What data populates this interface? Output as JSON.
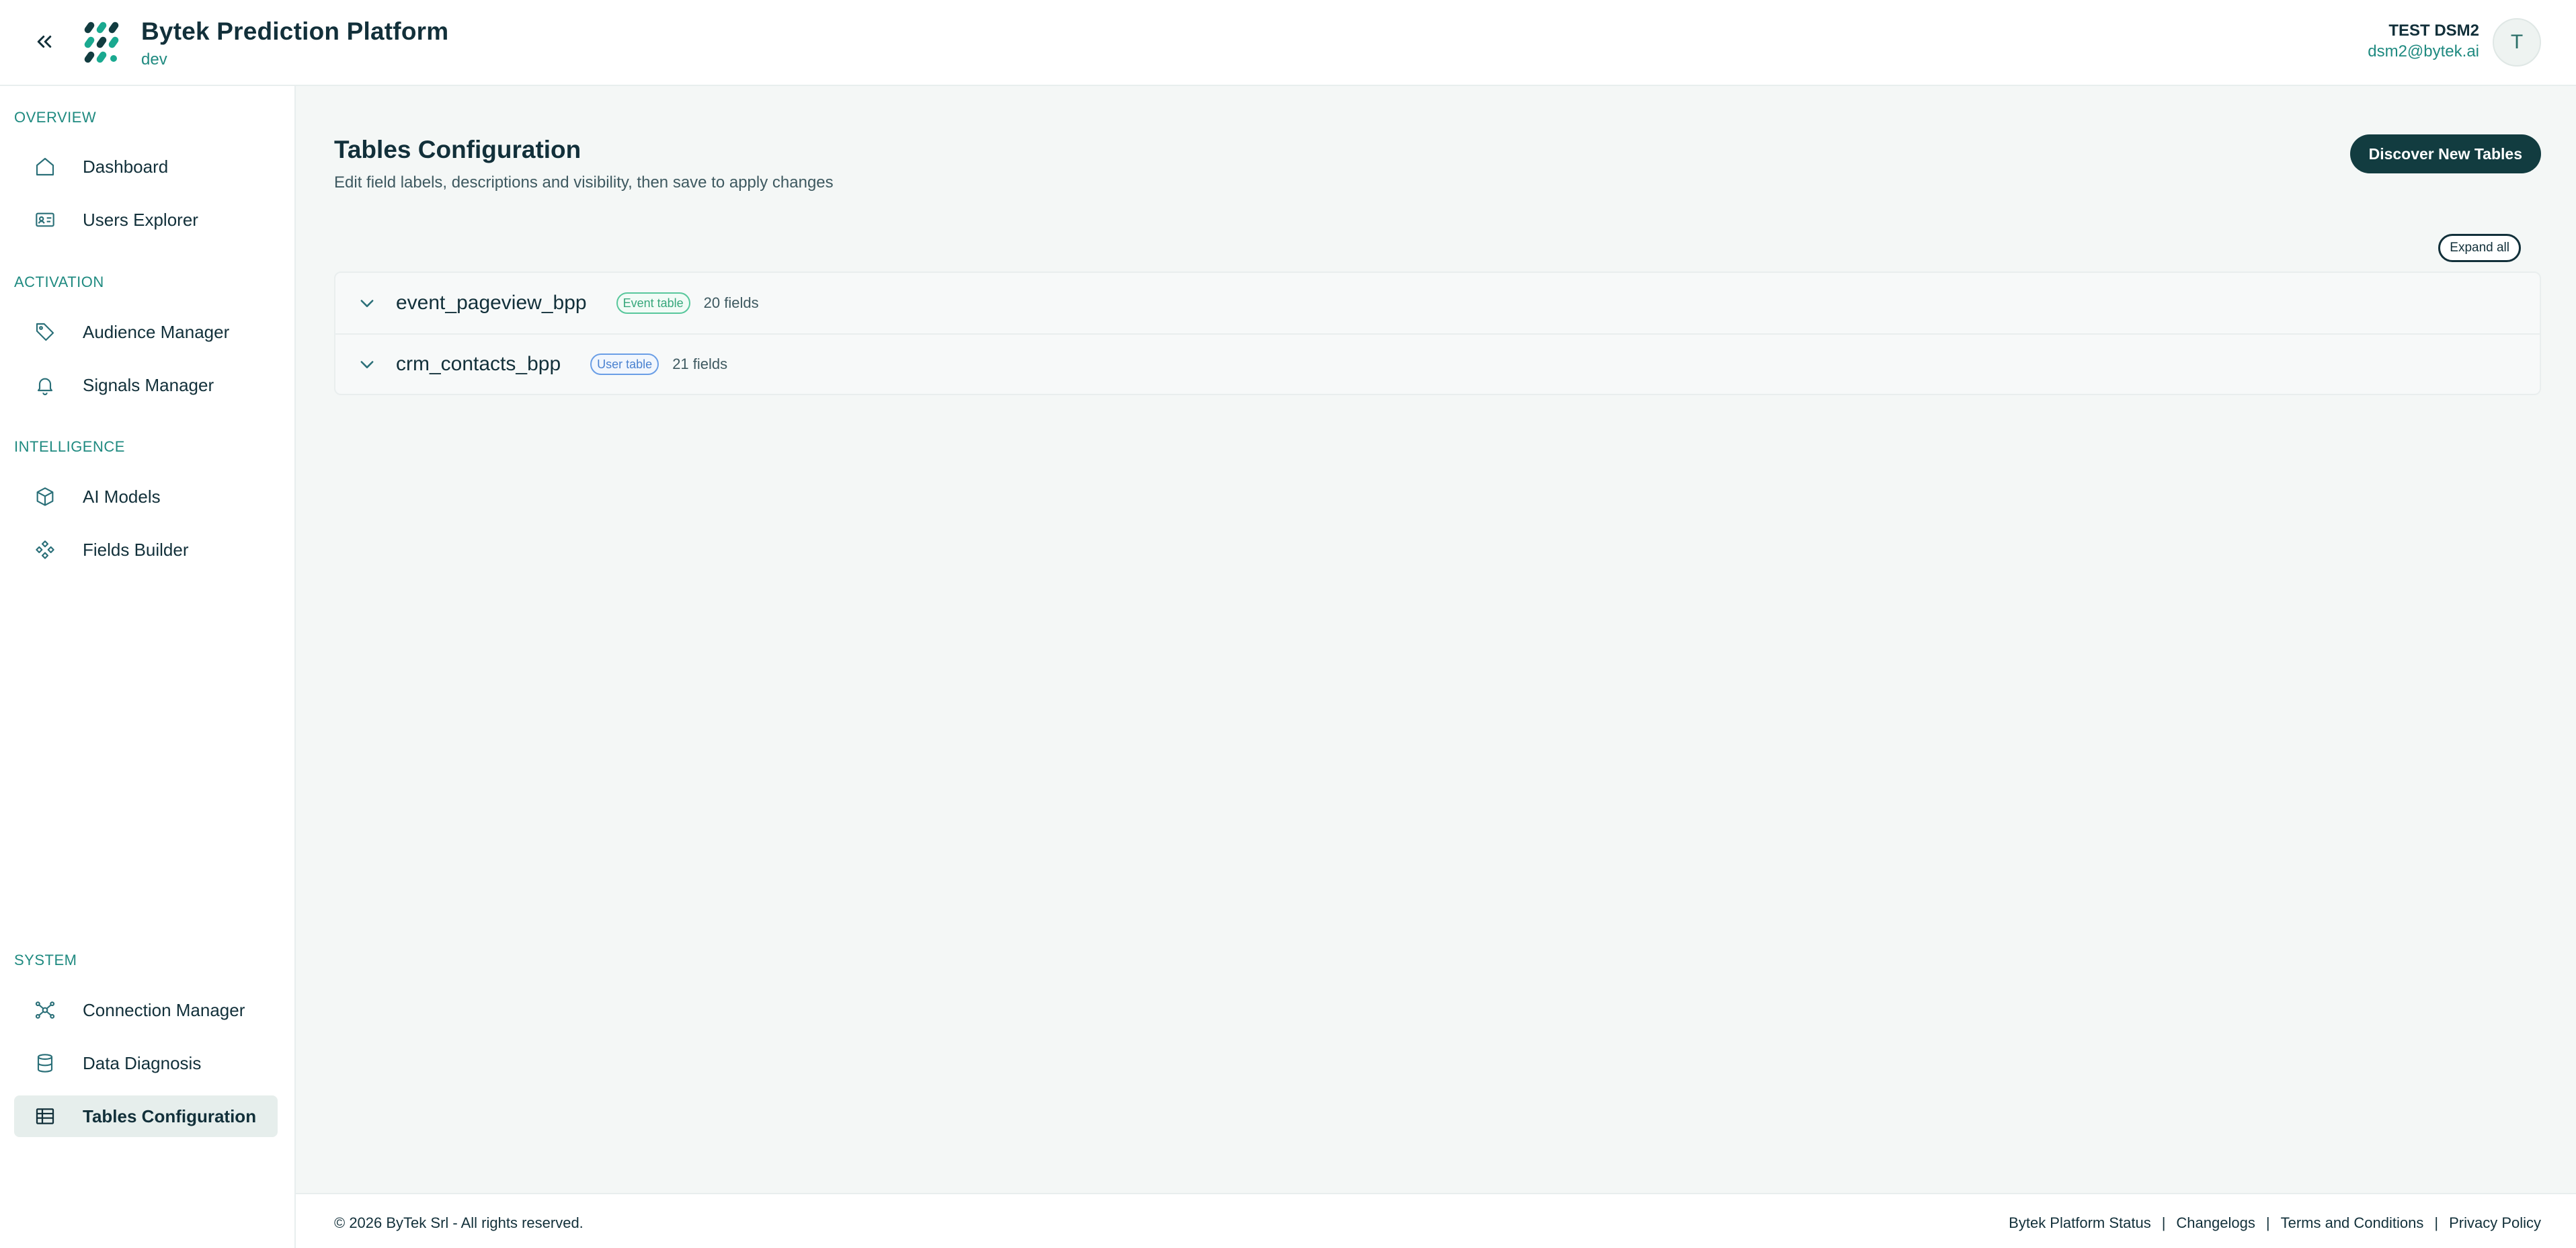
{
  "header": {
    "app_title": "Bytek Prediction Platform",
    "environment": "dev",
    "collapse_icon": "double-chevron-left-icon",
    "logo_icon": "bytek-logo",
    "user": {
      "name": "TEST DSM2",
      "email": "dsm2@bytek.ai",
      "avatar_initial": "T"
    }
  },
  "sidebar": {
    "sections": [
      {
        "label": "OVERVIEW",
        "items": [
          {
            "label": "Dashboard",
            "icon": "home-icon"
          },
          {
            "label": "Users Explorer",
            "icon": "id-card-icon"
          }
        ]
      },
      {
        "label": "ACTIVATION",
        "items": [
          {
            "label": "Audience Manager",
            "icon": "tag-icon"
          },
          {
            "label": "Signals Manager",
            "icon": "bell-icon"
          }
        ]
      },
      {
        "label": "INTELLIGENCE",
        "items": [
          {
            "label": "AI Models",
            "icon": "cube-icon"
          },
          {
            "label": "Fields Builder",
            "icon": "components-icon"
          }
        ]
      },
      {
        "label": "SYSTEM",
        "items": [
          {
            "label": "Connection Manager",
            "icon": "network-icon"
          },
          {
            "label": "Data Diagnosis",
            "icon": "database-icon"
          },
          {
            "label": "Tables Configuration",
            "icon": "table-icon",
            "active": true
          }
        ]
      }
    ]
  },
  "main": {
    "title": "Tables Configuration",
    "subtitle": "Edit field labels, descriptions and visibility, then save to apply changes",
    "discover_button": "Discover New Tables",
    "expand_all_button": "Expand all",
    "tables": [
      {
        "name": "event_pageview_bpp",
        "badge": "Event table",
        "badge_type": "event",
        "field_count": "20 fields",
        "icon": "chevron-down-icon"
      },
      {
        "name": "crm_contacts_bpp",
        "badge": "User table",
        "badge_type": "user",
        "field_count": "21 fields",
        "icon": "chevron-down-icon"
      }
    ]
  },
  "footer": {
    "copyright": "© 2026 ByTek Srl - All rights reserved.",
    "links": [
      "Bytek Platform Status",
      "Changelogs",
      "Terms and Conditions",
      "Privacy Policy"
    ],
    "separator": "|"
  },
  "colors": {
    "primary_dark": "#123c40",
    "accent_teal": "#1f8a80",
    "event_badge": "#36a77b",
    "user_badge": "#4a82d0",
    "main_background": "#f4f7f6",
    "active_nav_background": "#e6eeec"
  }
}
